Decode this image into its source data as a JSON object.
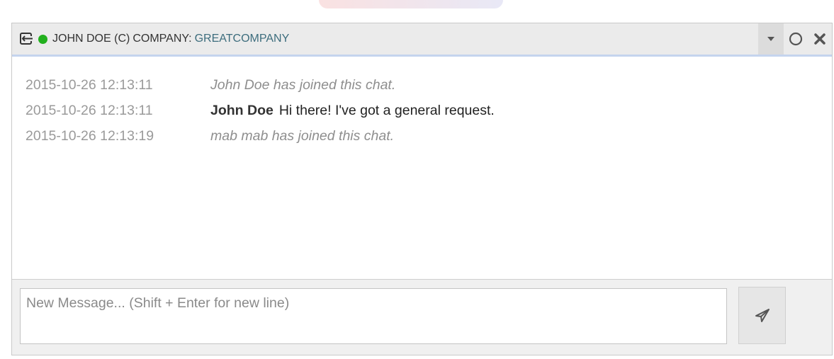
{
  "header": {
    "customer_name": "JOHN DOE (C)",
    "company_prefix": "COMPANY:",
    "company_name": "GREATCOMPANY",
    "status": "online",
    "status_color": "#22b01e",
    "icons": {
      "leave": "exit-icon",
      "collapse": "caret-down-icon",
      "minimize": "circle-icon",
      "close": "close-icon"
    }
  },
  "messages": [
    {
      "timestamp": "2015-10-26 12:13:11",
      "type": "system",
      "text": "John Doe has joined this chat."
    },
    {
      "timestamp": "2015-10-26 12:13:11",
      "type": "user",
      "sender": "John Doe",
      "text": "Hi there! I've got a general request."
    },
    {
      "timestamp": "2015-10-26 12:13:19",
      "type": "system",
      "text": "mab mab has joined this chat."
    }
  ],
  "composer": {
    "placeholder": "New Message... (Shift + Enter for new line)",
    "value": "",
    "send_icon": "paper-plane-icon"
  }
}
